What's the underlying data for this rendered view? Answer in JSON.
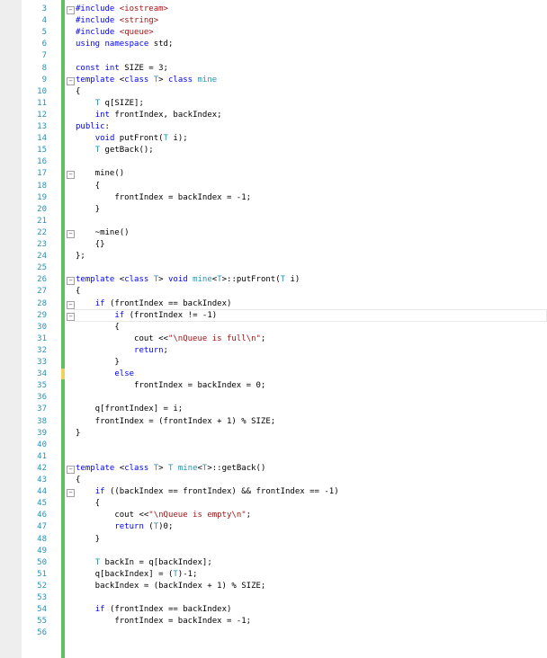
{
  "editor": {
    "colors": {
      "keyword": "#0000ff",
      "string": "#a31515",
      "type": "#2b91af",
      "line_number": "#2b91af",
      "change_bar": "#60c060"
    },
    "lines": [
      {
        "n": "3",
        "fold": "minus",
        "t": [
          [
            "kw",
            "#include "
          ],
          [
            "str",
            "<iostream>"
          ]
        ]
      },
      {
        "n": "4",
        "t": [
          [
            "kw",
            "#include "
          ],
          [
            "str",
            "<string>"
          ]
        ]
      },
      {
        "n": "5",
        "t": [
          [
            "kw",
            "#include "
          ],
          [
            "str",
            "<queue>"
          ]
        ]
      },
      {
        "n": "6",
        "t": [
          [
            "kw",
            "using namespace "
          ],
          [
            "",
            "std;"
          ]
        ]
      },
      {
        "n": "7",
        "t": []
      },
      {
        "n": "8",
        "t": [
          [
            "kw",
            "const int "
          ],
          [
            "",
            "SIZE = 3;"
          ]
        ]
      },
      {
        "n": "9",
        "fold": "minus",
        "t": [
          [
            "kw",
            "template "
          ],
          [
            "",
            "<"
          ],
          [
            "kw",
            "class "
          ],
          [
            "ty",
            "T"
          ],
          [
            "",
            "> "
          ],
          [
            "kw",
            "class "
          ],
          [
            "ty",
            "mine"
          ]
        ]
      },
      {
        "n": "10",
        "t": [
          [
            "",
            "{"
          ]
        ]
      },
      {
        "n": "11",
        "t": [
          [
            "",
            "    "
          ],
          [
            "ty",
            "T "
          ],
          [
            "",
            "q[SIZE];"
          ]
        ]
      },
      {
        "n": "12",
        "t": [
          [
            "",
            "    "
          ],
          [
            "kw",
            "int "
          ],
          [
            "",
            "frontIndex, backIndex;"
          ]
        ]
      },
      {
        "n": "13",
        "t": [
          [
            "kw",
            "public"
          ],
          [
            "",
            ":"
          ]
        ]
      },
      {
        "n": "14",
        "t": [
          [
            "",
            "    "
          ],
          [
            "kw",
            "void "
          ],
          [
            "",
            "putFront("
          ],
          [
            "ty",
            "T "
          ],
          [
            "",
            "i);"
          ]
        ]
      },
      {
        "n": "15",
        "t": [
          [
            "",
            "    "
          ],
          [
            "ty",
            "T "
          ],
          [
            "",
            "getBack();"
          ]
        ]
      },
      {
        "n": "16",
        "t": []
      },
      {
        "n": "17",
        "fold": "minus",
        "t": [
          [
            "",
            "    mine()"
          ]
        ]
      },
      {
        "n": "18",
        "t": [
          [
            "",
            "    {"
          ]
        ]
      },
      {
        "n": "19",
        "t": [
          [
            "",
            "        frontIndex = backIndex = -1;"
          ]
        ]
      },
      {
        "n": "20",
        "t": [
          [
            "",
            "    }"
          ]
        ]
      },
      {
        "n": "21",
        "t": []
      },
      {
        "n": "22",
        "fold": "minus",
        "t": [
          [
            "",
            "    ~mine()"
          ]
        ]
      },
      {
        "n": "23",
        "t": [
          [
            "",
            "    {}"
          ]
        ]
      },
      {
        "n": "24",
        "t": [
          [
            "",
            "};"
          ]
        ]
      },
      {
        "n": "25",
        "t": []
      },
      {
        "n": "26",
        "fold": "minus",
        "t": [
          [
            "kw",
            "template "
          ],
          [
            "",
            "<"
          ],
          [
            "kw",
            "class "
          ],
          [
            "ty",
            "T"
          ],
          [
            "",
            "> "
          ],
          [
            "kw",
            "void "
          ],
          [
            "ty",
            "mine"
          ],
          [
            "",
            "<"
          ],
          [
            "ty",
            "T"
          ],
          [
            "",
            ">::putFront("
          ],
          [
            "ty",
            "T "
          ],
          [
            "",
            "i)"
          ]
        ]
      },
      {
        "n": "27",
        "t": [
          [
            "",
            "{"
          ]
        ]
      },
      {
        "n": "28",
        "fold": "minus",
        "t": [
          [
            "",
            "    "
          ],
          [
            "kw",
            "if "
          ],
          [
            "",
            "(frontIndex == backIndex)"
          ]
        ]
      },
      {
        "n": "29",
        "fold": "minus",
        "t": [
          [
            "",
            "        "
          ],
          [
            "kw",
            "if "
          ],
          [
            "",
            "(frontIndex != -1)"
          ]
        ]
      },
      {
        "n": "30",
        "t": [
          [
            "",
            "        {"
          ]
        ]
      },
      {
        "n": "31",
        "t": [
          [
            "",
            "            cout <<"
          ],
          [
            "str",
            "\"\\nQueue is full\\n\""
          ],
          [
            "",
            ";"
          ]
        ]
      },
      {
        "n": "32",
        "t": [
          [
            "",
            "            "
          ],
          [
            "kw",
            "return"
          ],
          [
            "",
            ";"
          ]
        ]
      },
      {
        "n": "33",
        "t": [
          [
            "",
            "        }"
          ]
        ]
      },
      {
        "n": "34",
        "mark": true,
        "t": [
          [
            "",
            "        "
          ],
          [
            "kw",
            "else"
          ]
        ]
      },
      {
        "n": "35",
        "t": [
          [
            "",
            "            frontIndex = backIndex = 0;"
          ]
        ]
      },
      {
        "n": "36",
        "t": []
      },
      {
        "n": "37",
        "t": [
          [
            "",
            "    q[frontIndex] = i;"
          ]
        ]
      },
      {
        "n": "38",
        "t": [
          [
            "",
            "    frontIndex = (frontIndex + 1) % SIZE;"
          ]
        ]
      },
      {
        "n": "39",
        "t": [
          [
            "",
            "}"
          ]
        ]
      },
      {
        "n": "40",
        "t": []
      },
      {
        "n": "41",
        "t": []
      },
      {
        "n": "42",
        "fold": "minus",
        "t": [
          [
            "kw",
            "template "
          ],
          [
            "",
            "<"
          ],
          [
            "kw",
            "class "
          ],
          [
            "ty",
            "T"
          ],
          [
            "",
            "> "
          ],
          [
            "ty",
            "T mine"
          ],
          [
            "",
            "<"
          ],
          [
            "ty",
            "T"
          ],
          [
            "",
            ">::getBack()"
          ]
        ]
      },
      {
        "n": "43",
        "t": [
          [
            "",
            "{"
          ]
        ]
      },
      {
        "n": "44",
        "fold": "minus",
        "t": [
          [
            "",
            "    "
          ],
          [
            "kw",
            "if "
          ],
          [
            "",
            "((backIndex == frontIndex) && frontIndex == -1)"
          ]
        ]
      },
      {
        "n": "45",
        "t": [
          [
            "",
            "    {"
          ]
        ]
      },
      {
        "n": "46",
        "t": [
          [
            "",
            "        cout <<"
          ],
          [
            "str",
            "\"\\nQueue is empty\\n\""
          ],
          [
            "",
            ";"
          ]
        ]
      },
      {
        "n": "47",
        "t": [
          [
            "",
            "        "
          ],
          [
            "kw",
            "return "
          ],
          [
            "",
            "("
          ],
          [
            "ty",
            "T"
          ],
          [
            "",
            ")0;"
          ]
        ]
      },
      {
        "n": "48",
        "t": [
          [
            "",
            "    }"
          ]
        ]
      },
      {
        "n": "49",
        "t": []
      },
      {
        "n": "50",
        "t": [
          [
            "",
            "    "
          ],
          [
            "ty",
            "T "
          ],
          [
            "",
            "backIn = q[backIndex];"
          ]
        ]
      },
      {
        "n": "51",
        "t": [
          [
            "",
            "    q[backIndex] = ("
          ],
          [
            "ty",
            "T"
          ],
          [
            "",
            ")-1;"
          ]
        ]
      },
      {
        "n": "52",
        "t": [
          [
            "",
            "    backIndex = (backIndex + 1) % SIZE;"
          ]
        ]
      },
      {
        "n": "53",
        "t": []
      },
      {
        "n": "54",
        "t": [
          [
            "",
            "    "
          ],
          [
            "kw",
            "if "
          ],
          [
            "",
            "(frontIndex == backIndex)"
          ]
        ]
      },
      {
        "n": "55",
        "t": [
          [
            "",
            "        frontIndex = backIndex = -1;"
          ]
        ]
      },
      {
        "n": "56",
        "t": []
      }
    ]
  }
}
